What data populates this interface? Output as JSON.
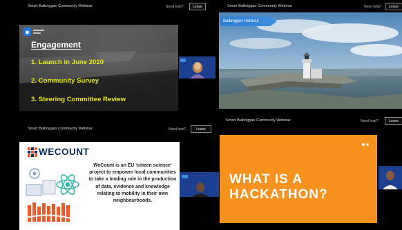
{
  "panels": {
    "top_left": {
      "window_title": "Smart Balbriggan Community Webinar",
      "help_label": "Need help?",
      "leave_label": "Leave",
      "slide": {
        "heading": "Engagement",
        "items": [
          "1. Launch in June 2020",
          "2. Community Survey",
          "3. Steering Committee Review"
        ]
      }
    },
    "top_right": {
      "window_title": "Smart Balbriggan Community Webinar",
      "help_label": "Need help?",
      "leave_label": "Leave",
      "location_label": "Balbriggan Harbour"
    },
    "bottom_left": {
      "window_title": "Smart Balbriggan Community Webinar",
      "help_label": "Need help?",
      "leave_label": "Leave",
      "slide": {
        "logo": "WECOUNT",
        "description": "WeCount is an EU ‘citizen science’ project to empower local communities to take a leading role in the production of data, evidence and knowledge relating to mobility in their own neighbourhoods."
      }
    },
    "bottom_right": {
      "window_title": "Smart Balbriggan Community Webinar",
      "help_label": "Need help?",
      "leave_label": "Leave",
      "slide": {
        "line1": "WHAT IS A",
        "line2": "HACKATHON?"
      }
    }
  },
  "colors": {
    "highlight_yellow": "#e8e814",
    "orange": "#f7921e",
    "navy": "#0a2e5a",
    "harbour_blue": "#2d7fd4"
  }
}
